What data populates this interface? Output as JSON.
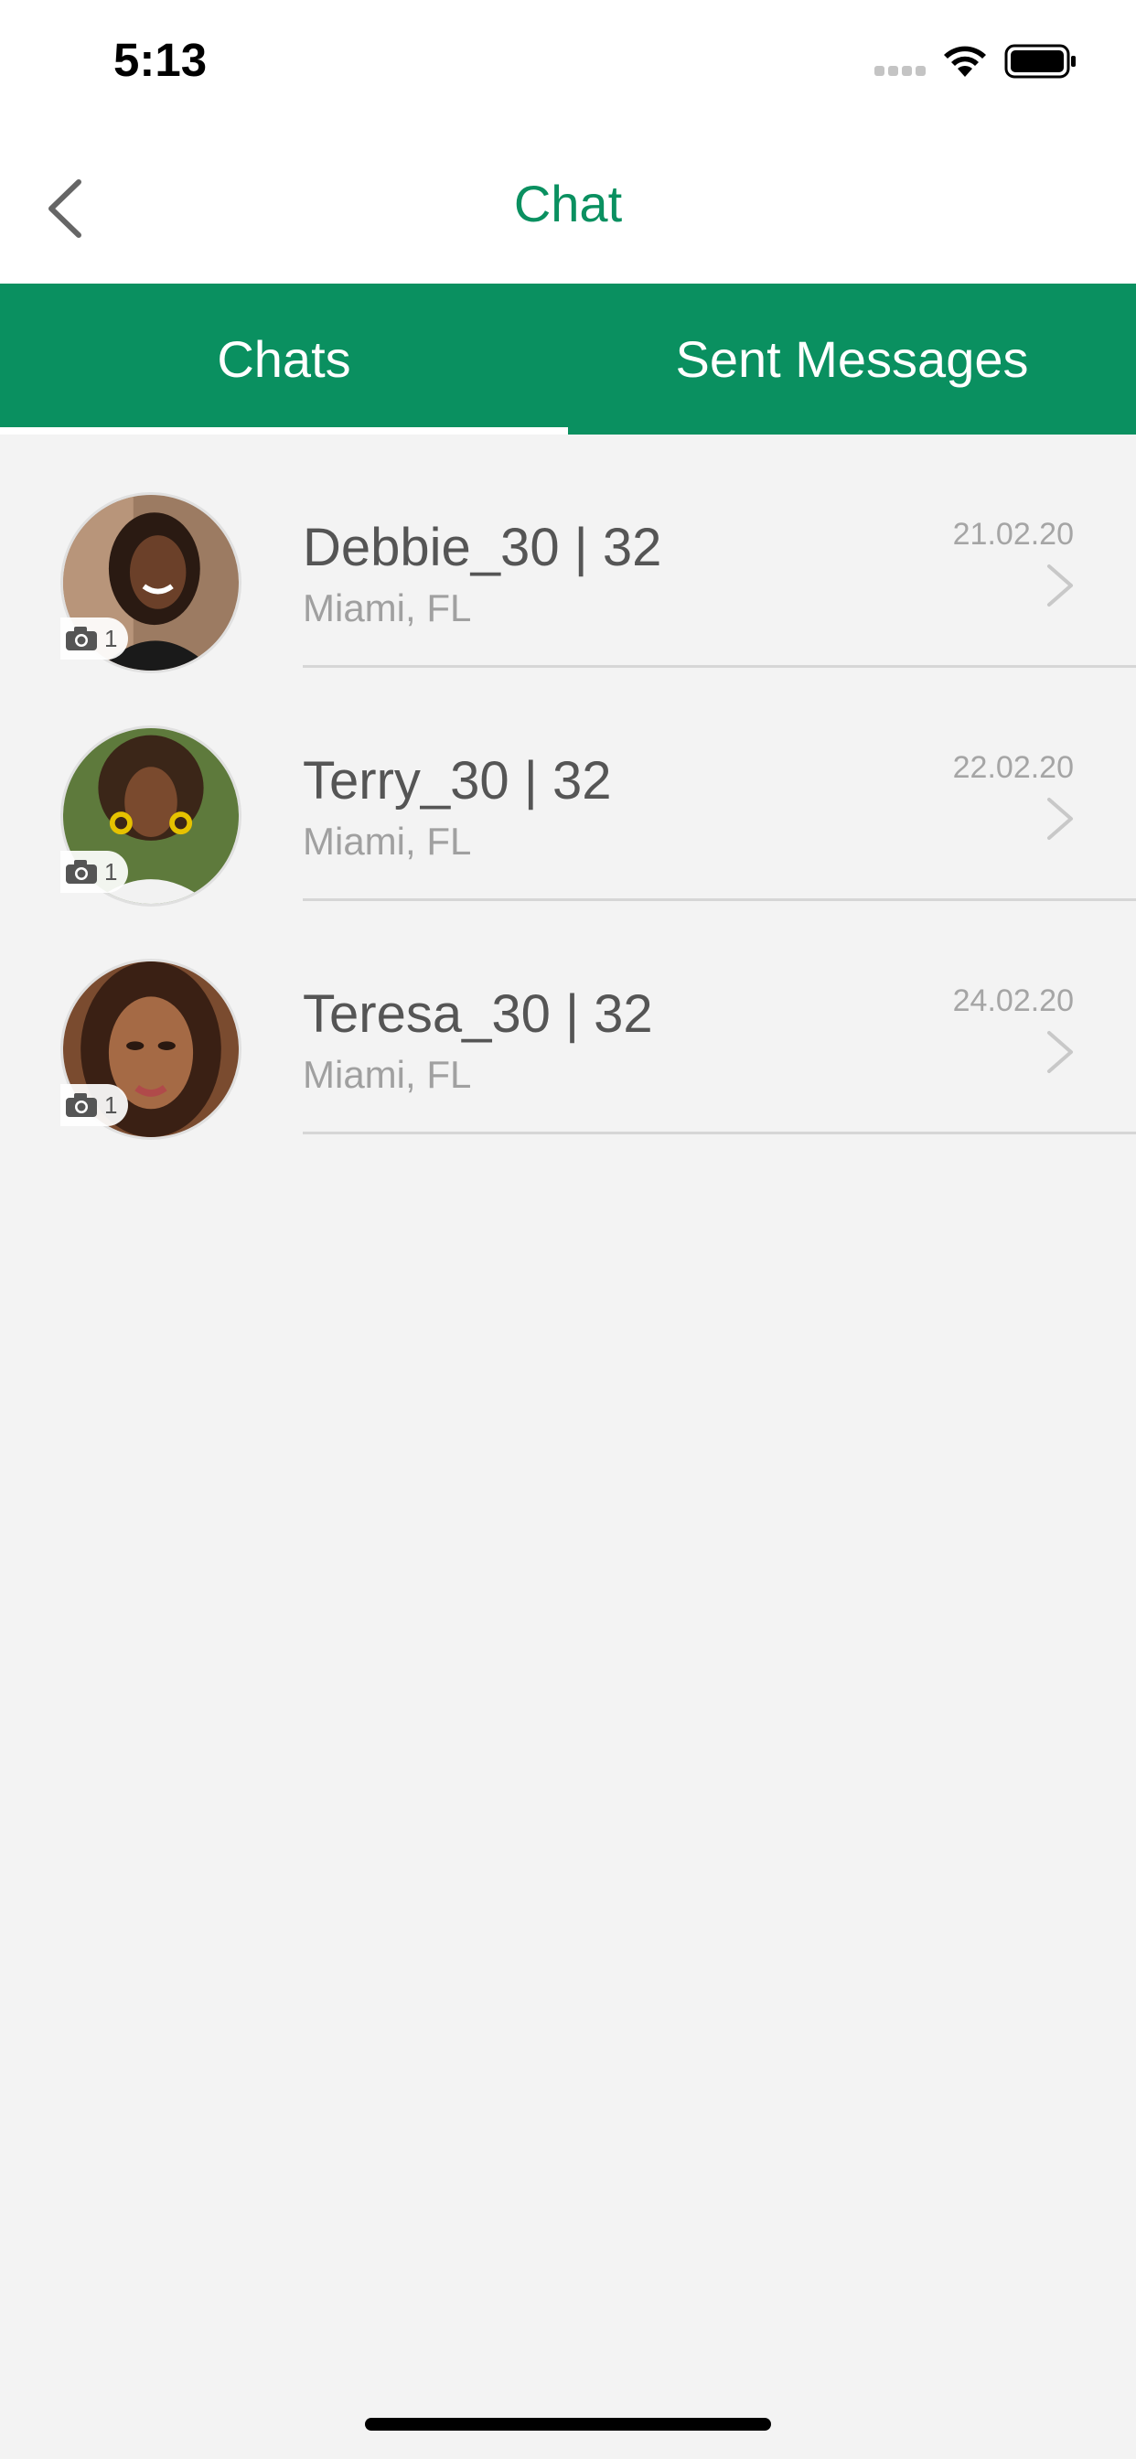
{
  "status": {
    "time": "5:13"
  },
  "nav": {
    "title": "Chat"
  },
  "tabs": [
    {
      "label": "Chats",
      "active": true
    },
    {
      "label": "Sent Messages",
      "active": false
    }
  ],
  "chats": [
    {
      "name": "Debbie_30 | 32",
      "location": "Miami, FL",
      "date": "21.02.20",
      "photo_count": "1"
    },
    {
      "name": "Terry_30 | 32",
      "location": "Miami, FL",
      "date": "22.02.20",
      "photo_count": "1"
    },
    {
      "name": "Teresa_30 | 32",
      "location": "Miami, FL",
      "date": "24.02.20",
      "photo_count": "1"
    }
  ],
  "colors": {
    "brand_green": "#0a9060",
    "background": "#f3f3f3"
  }
}
